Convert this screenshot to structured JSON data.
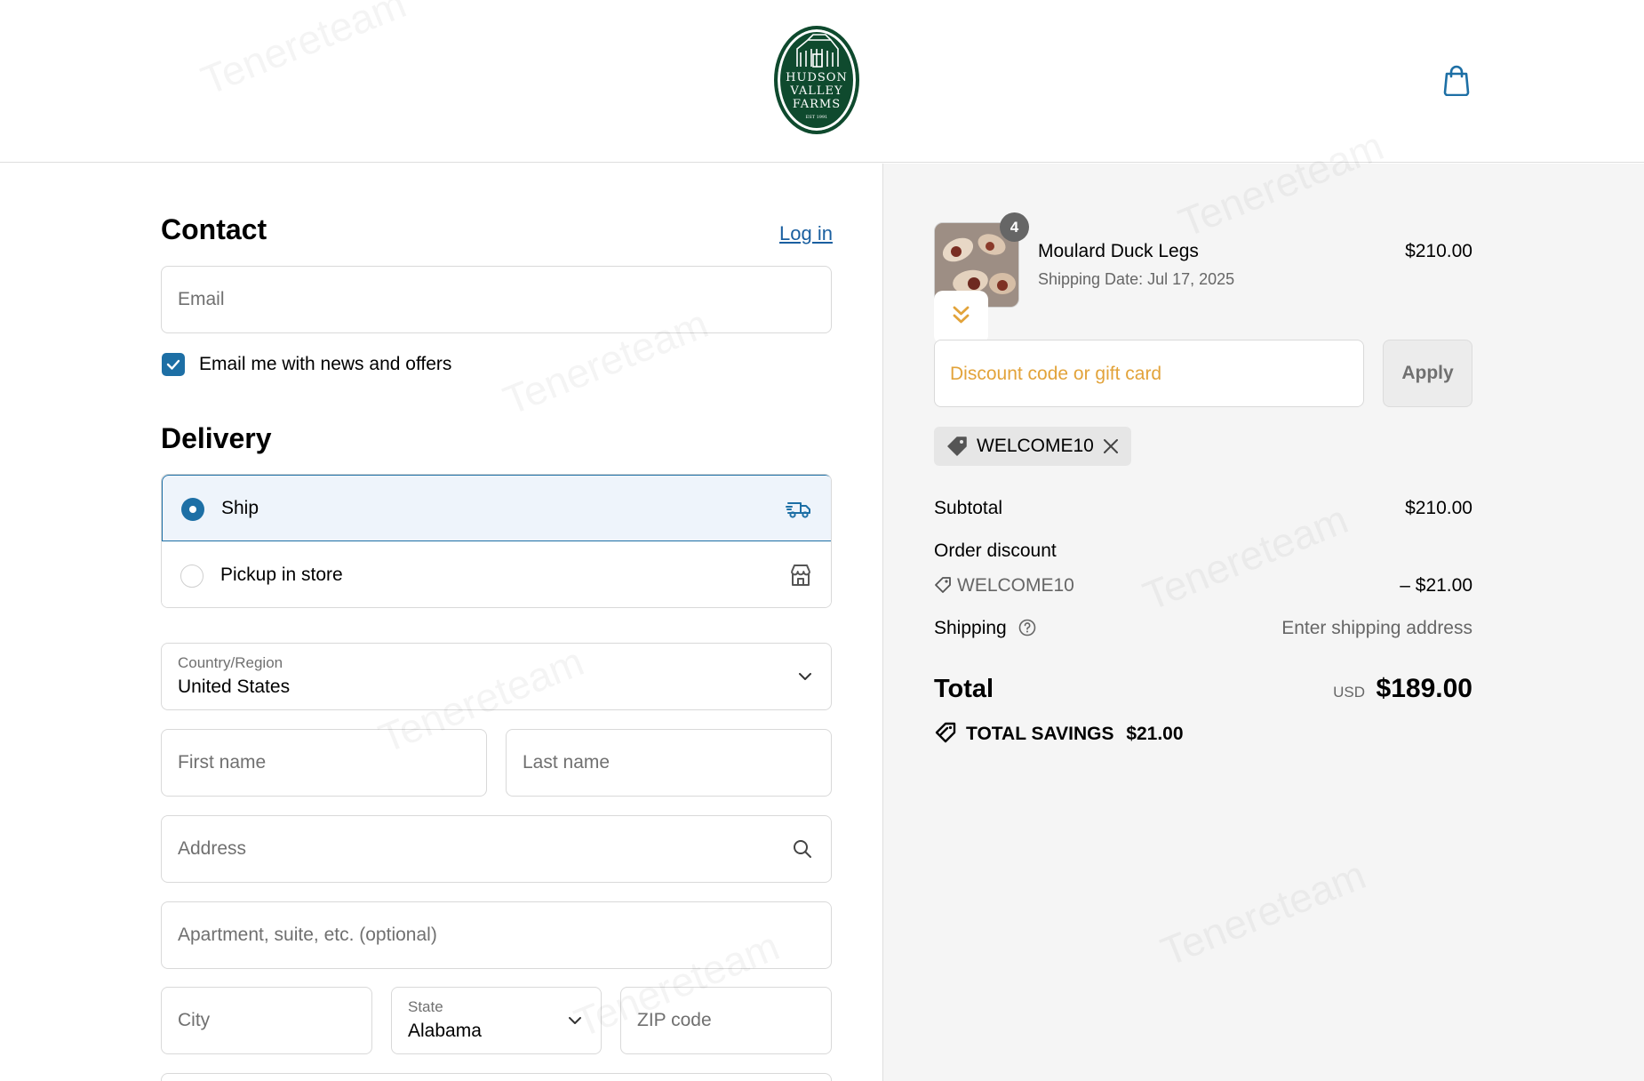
{
  "brand": {
    "logo_lines": [
      "HUDSON",
      "VALLEY",
      "FARMS"
    ],
    "logo_est": "EST 1991",
    "colors": {
      "logo_green": "#0f4a2e",
      "accent_blue": "#1d6fa5",
      "discount_orange": "#e2a33a"
    }
  },
  "header": {
    "cart_icon": "shopping-bag-icon"
  },
  "contact": {
    "title": "Contact",
    "login_label": "Log in",
    "email_placeholder": "Email",
    "newsletter_label": "Email me with news and offers",
    "newsletter_checked": true
  },
  "delivery": {
    "title": "Delivery",
    "options": [
      {
        "label": "Ship",
        "selected": true,
        "icon": "truck-icon"
      },
      {
        "label": "Pickup in store",
        "selected": false,
        "icon": "store-icon"
      }
    ],
    "country_label": "Country/Region",
    "country_value": "United States",
    "first_name_placeholder": "First name",
    "last_name_placeholder": "Last name",
    "address_placeholder": "Address",
    "apartment_placeholder": "Apartment, suite, etc. (optional)",
    "city_placeholder": "City",
    "state_label": "State",
    "state_value": "Alabama",
    "zip_placeholder": "ZIP code"
  },
  "summary": {
    "item": {
      "name": "Moulard Duck Legs",
      "shipping_date": "Shipping Date: Jul 17, 2025",
      "price": "$210.00",
      "quantity": "4"
    },
    "discount_placeholder": "Discount code or gift card",
    "apply_label": "Apply",
    "applied_code": "WELCOME10",
    "subtotal_label": "Subtotal",
    "subtotal_value": "$210.00",
    "order_discount_label": "Order discount",
    "order_discount_code": "WELCOME10",
    "order_discount_value": "– $21.00",
    "shipping_label": "Shipping",
    "shipping_value": "Enter shipping address",
    "total_label": "Total",
    "total_currency": "USD",
    "total_value": "$189.00",
    "savings_label": "TOTAL SAVINGS",
    "savings_value": "$21.00"
  },
  "watermark": "Tenereteam"
}
